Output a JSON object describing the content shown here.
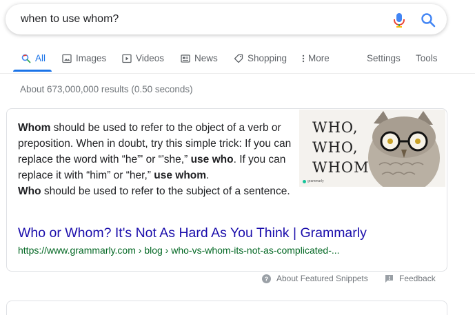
{
  "search": {
    "query": "when to use whom?"
  },
  "tabs": [
    {
      "label": "All",
      "icon": "search-icon",
      "active": true
    },
    {
      "label": "Images",
      "icon": "image-icon"
    },
    {
      "label": "Videos",
      "icon": "video-icon"
    },
    {
      "label": "News",
      "icon": "news-icon"
    },
    {
      "label": "Shopping",
      "icon": "tag-icon"
    },
    {
      "label": "More",
      "icon": "more-vert-icon"
    },
    {
      "label": "Settings"
    },
    {
      "label": "Tools"
    }
  ],
  "results_count": "About 673,000,000 results (0.50 seconds)",
  "featured": {
    "snippet": [
      {
        "text": "Whom",
        "bold": true
      },
      {
        "text": " should be used to refer to the object of a verb or preposition. When in doubt, try this simple trick: If you can replace the word with “he”' or “'she,” "
      },
      {
        "text": "use who",
        "bold": true
      },
      {
        "text": ". If you can replace it with “him” or “her,” "
      },
      {
        "text": "use whom",
        "bold": true
      },
      {
        "text": ". "
      },
      {
        "text": "Who",
        "bold": true
      },
      {
        "text": " should be used to refer to the subject of a sentence."
      }
    ],
    "image_lines": [
      "WHO,",
      "WHO,",
      "WHOM!"
    ],
    "image_brand": "grammarly",
    "link_title": "Who or Whom? It's Not As Hard As You Think | Grammarly",
    "link_url": "https://www.grammarly.com › blog › who-vs-whom-its-not-as-complicated-..."
  },
  "footer": {
    "about_label": "About Featured Snippets",
    "feedback_label": "Feedback"
  },
  "colors": {
    "accent": "#1a73e8",
    "link": "#1a0dab",
    "url": "#006621",
    "muted": "#70757a"
  }
}
